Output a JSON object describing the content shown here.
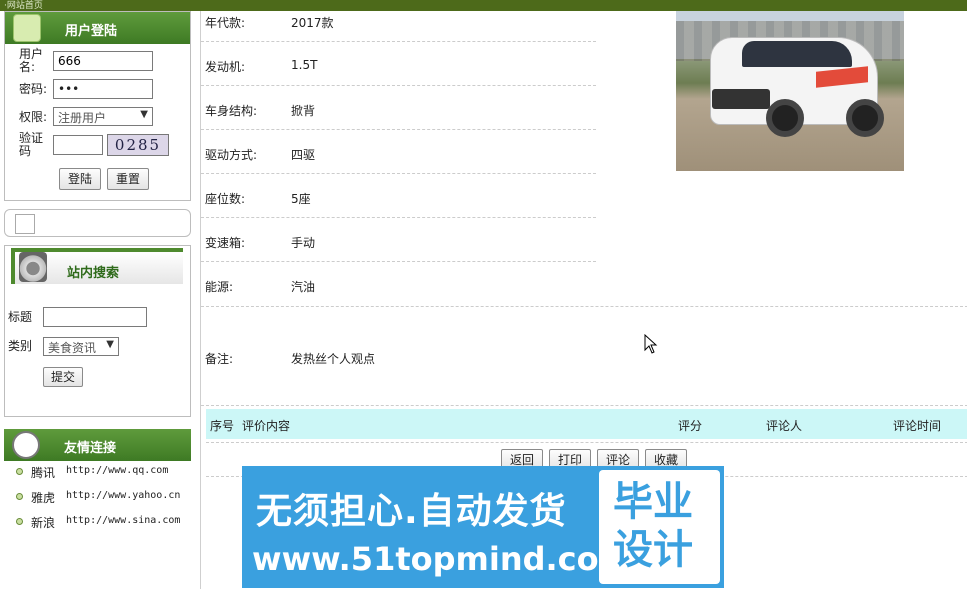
{
  "top_bar": {
    "title": "·网站首页"
  },
  "login": {
    "title": "用户登陆",
    "username_label": "用户名:",
    "username_value": "666",
    "password_label": "密码:",
    "password_value": "•••",
    "role_label": "权限:",
    "role_value": "注册用户",
    "captcha_label": "验证码",
    "captcha_value": "",
    "captcha_image_text": "0285",
    "login_button": "登陆",
    "reset_button": "重置"
  },
  "search": {
    "title": "站内搜索",
    "title_label": "标题",
    "title_value": "",
    "category_label": "类别",
    "category_value": "美食资讯",
    "submit_button": "提交"
  },
  "links": {
    "title": "友情连接",
    "items": [
      {
        "name": "腾讯",
        "url": "http://www.qq.com"
      },
      {
        "name": "雅虎",
        "url": "http://www.yahoo.cn"
      },
      {
        "name": "新浪",
        "url": "http://www.sina.com"
      }
    ]
  },
  "details": {
    "rows": [
      {
        "key": "年代款:",
        "value": "2017款"
      },
      {
        "key": "发动机:",
        "value": "1.5T"
      },
      {
        "key": "车身结构:",
        "value": "掀背"
      },
      {
        "key": "驱动方式:",
        "value": "四驱"
      },
      {
        "key": "座位数:",
        "value": "5座"
      },
      {
        "key": "变速箱:",
        "value": "手动"
      },
      {
        "key": "能源:",
        "value": "汽油"
      }
    ],
    "note_key": "备注:",
    "note_value": "发热丝个人观点"
  },
  "reviews": {
    "headers": [
      "序号",
      "评价内容",
      "评分",
      "评论人",
      "评论时间"
    ]
  },
  "actions": {
    "back": "返回",
    "print": "打印",
    "comment": "评论",
    "favorite": "收藏"
  },
  "banner": {
    "line1": "无须担心.自动发货",
    "line2": "www.51topmind.com",
    "badge_line1": "毕业",
    "badge_line2": "设计"
  }
}
